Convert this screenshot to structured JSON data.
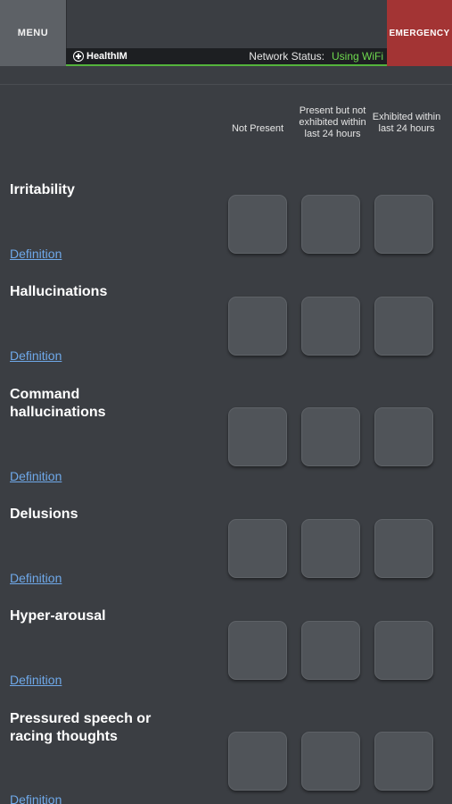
{
  "header": {
    "menu_label": "MENU",
    "emergency_label": "EMERGENCY",
    "brand": "HealthIM",
    "network_status_label": "Network Status:",
    "network_status_value": "Using WiFi"
  },
  "columns": [
    {
      "label": "Not Present"
    },
    {
      "label": "Present but not exhibited within last 24 hours"
    },
    {
      "label": "Exhibited within last 24 hours"
    }
  ],
  "definition_label": "Definition",
  "symptoms": [
    {
      "title": "Irritability"
    },
    {
      "title": "Hallucinations"
    },
    {
      "title": "Command hallucinations"
    },
    {
      "title": "Delusions"
    },
    {
      "title": "Hyper-arousal"
    },
    {
      "title": "Pressured speech or racing thoughts"
    }
  ],
  "colors": {
    "background": "#3b3e43",
    "emergency": "#a33434",
    "status_green": "#6fd94f",
    "link": "#6fa9ea"
  }
}
